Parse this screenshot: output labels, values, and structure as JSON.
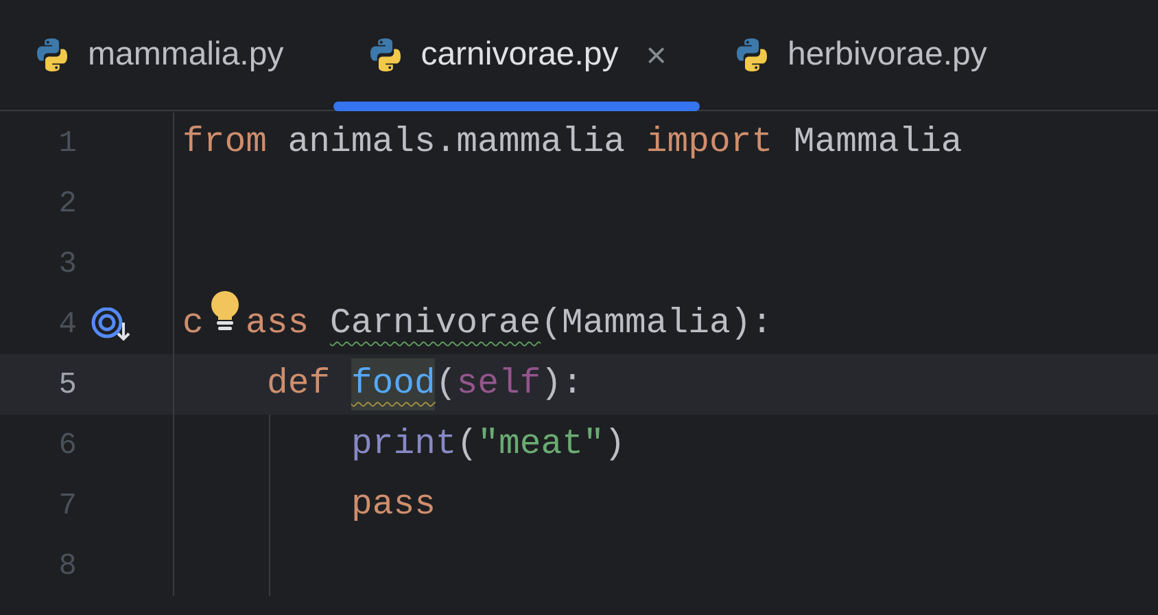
{
  "tabs": [
    {
      "label": "mammalia.py",
      "selected": false
    },
    {
      "label": "carnivorae.py",
      "selected": true,
      "close": "×"
    },
    {
      "label": "herbivorae.py",
      "selected": false
    }
  ],
  "lines": [
    {
      "number": "1",
      "current": false,
      "tokens": [
        {
          "text": "from",
          "kind": "keyword"
        },
        {
          "text": "animals.mammalia",
          "kind": "plain",
          "spaced": true
        },
        {
          "text": "import",
          "kind": "keyword",
          "spaced": true
        },
        {
          "text": "Mammalia",
          "kind": "plain",
          "spaced": true
        }
      ]
    },
    {
      "number": "2",
      "current": false
    },
    {
      "number": "3",
      "current": false
    },
    {
      "number": "4",
      "current": false,
      "overridden": true,
      "tokens": [
        {
          "text": "c",
          "kind": "keyword"
        },
        {
          "kind": "bulb"
        },
        {
          "text": "ass",
          "kind": "keyword"
        },
        {
          "text": "Carnivorae",
          "kind": "plain",
          "spaced": true,
          "typo": true
        },
        {
          "text": "(Mammalia):",
          "kind": "plain"
        }
      ],
      "children": [
        {
          "number": "5",
          "current": true,
          "tokens": [
            {
              "text": "def",
              "kind": "keyword"
            },
            {
              "text": "food",
              "kind": "function",
              "spaced": true,
              "warning": true,
              "highlighted": true
            },
            {
              "text": "(",
              "kind": "plain"
            },
            {
              "text": "self",
              "kind": "self"
            },
            {
              "text": "):",
              "kind": "plain"
            }
          ],
          "children": [
            {
              "number": "6",
              "current": false,
              "tokens": [
                {
                  "text": "print",
                  "kind": "builtin"
                },
                {
                  "text": "(",
                  "kind": "plain"
                },
                {
                  "text": "\"meat\"",
                  "kind": "string"
                },
                {
                  "text": ")",
                  "kind": "plain"
                }
              ]
            },
            {
              "number": "7",
              "current": false,
              "tokens": [
                {
                  "text": "pass",
                  "kind": "keyword"
                }
              ]
            },
            {
              "number": "8",
              "current": false
            }
          ]
        }
      ]
    }
  ]
}
